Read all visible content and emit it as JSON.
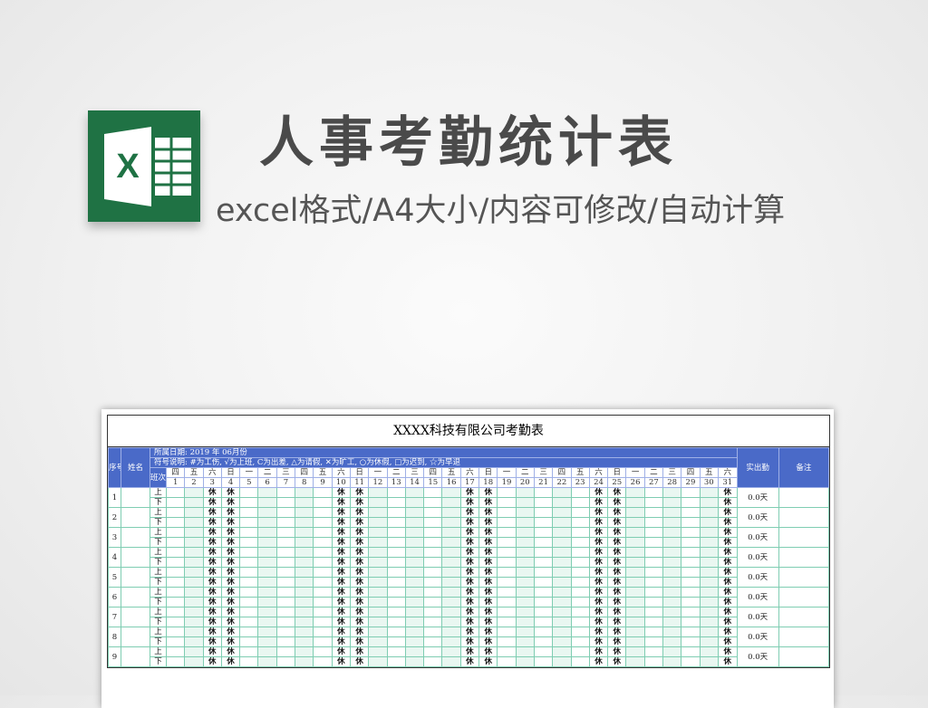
{
  "header": {
    "title": "人事考勤统计表",
    "subtitle": "excel格式/A4大小/内容可修改/自动计算",
    "logo_letter": "X",
    "logo_color": "#1f7244"
  },
  "sheet": {
    "title": "XXXX科技有限公司考勤表",
    "period_label": "所属日期:",
    "period_value": "2019 年 06月份",
    "legend_label": "符号说明:",
    "legend_text": "#为工伤, √为上班, C为出差, △为请假, ✕为旷工, ○为休假, □为迟到, ☆为早退",
    "col_seq": "序号",
    "col_name": "姓名",
    "col_shift_top": "班",
    "col_shift_bottom": "次",
    "col_actual": "实出勤",
    "col_remark": "备注",
    "weekdays": [
      "六",
      "日",
      "一",
      "二",
      "三",
      "四",
      "五",
      "六",
      "日",
      "一",
      "二",
      "三",
      "四",
      "五",
      "六",
      "日",
      "一",
      "二",
      "三",
      "四",
      "五",
      "六",
      "日",
      "一",
      "二",
      "三",
      "四",
      "五",
      "六",
      "日",
      "一"
    ],
    "weekdays_visible": [
      "四",
      "五",
      "六",
      "日",
      "一",
      "二",
      "三",
      "四",
      "五",
      "六",
      "日",
      "一",
      "二",
      "三",
      "四",
      "五",
      "六",
      "日",
      "一",
      "二",
      "三",
      "四",
      "五",
      "六",
      "日",
      "一",
      "二",
      "三",
      "四",
      "五",
      "六"
    ],
    "days": [
      "1",
      "2",
      "3",
      "4",
      "5",
      "6",
      "7",
      "8",
      "9",
      "10",
      "11",
      "12",
      "13",
      "14",
      "15",
      "16",
      "17",
      "18",
      "19",
      "20",
      "21",
      "22",
      "23",
      "24",
      "25",
      "26",
      "27",
      "28",
      "29",
      "30",
      "31"
    ],
    "shift_am": "上",
    "shift_pm": "下",
    "rest_mark": "休",
    "rest_days": [
      3,
      4,
      10,
      11,
      17,
      18,
      24,
      25,
      31
    ],
    "rows": [
      {
        "no": "1",
        "total": "0.0天"
      },
      {
        "no": "2",
        "total": "0.0天"
      },
      {
        "no": "3",
        "total": "0.0天"
      },
      {
        "no": "4",
        "total": "0.0天"
      },
      {
        "no": "5",
        "total": "0.0天"
      },
      {
        "no": "6",
        "total": "0.0天"
      },
      {
        "no": "7",
        "total": "0.0天"
      },
      {
        "no": "8",
        "total": "0.0天"
      },
      {
        "no": "9",
        "total": "0.0天"
      }
    ],
    "header_color": "#4a6ac8",
    "grid_color": "#7fcdb2"
  }
}
